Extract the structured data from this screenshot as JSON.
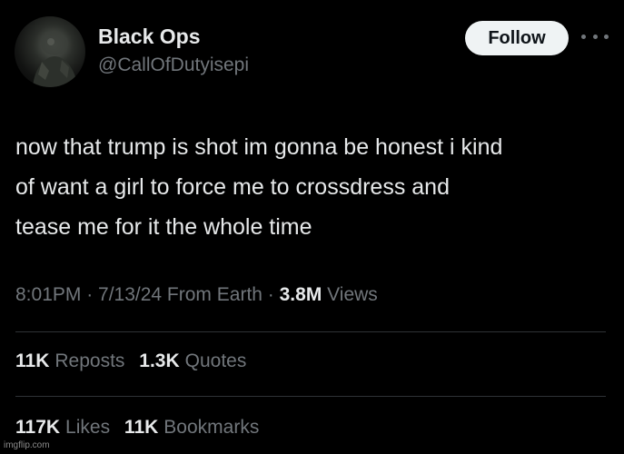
{
  "author": {
    "name": "Black Ops",
    "handle": "@CallOfDutyisepi"
  },
  "follow_label": "Follow",
  "tweet": {
    "lines": [
      "now that trump is shot im gonna be honest i kind",
      "of want a girl to force me to crossdress and",
      "tease me for it the whole time"
    ]
  },
  "meta": {
    "timestamp": "8:01PM · 7/13/24 From Earth · ",
    "views_count": "3.8M",
    "views_label": " Views"
  },
  "stats": {
    "reposts_count": "11K",
    "reposts_label": "Reposts",
    "quotes_count": "1.3K",
    "quotes_label": "Quotes",
    "likes_count": "117K",
    "likes_label": "Likes",
    "bookmarks_count": "11K",
    "bookmarks_label": "Bookmarks"
  },
  "watermark": "imgflip.com",
  "colors": {
    "background": "#000000",
    "primary_text": "#e7e9ea",
    "secondary_text": "#71767b",
    "follow_button_bg": "#eff3f4",
    "divider": "#2f3336"
  },
  "icons": {
    "more": "more-horizontal-icon"
  }
}
